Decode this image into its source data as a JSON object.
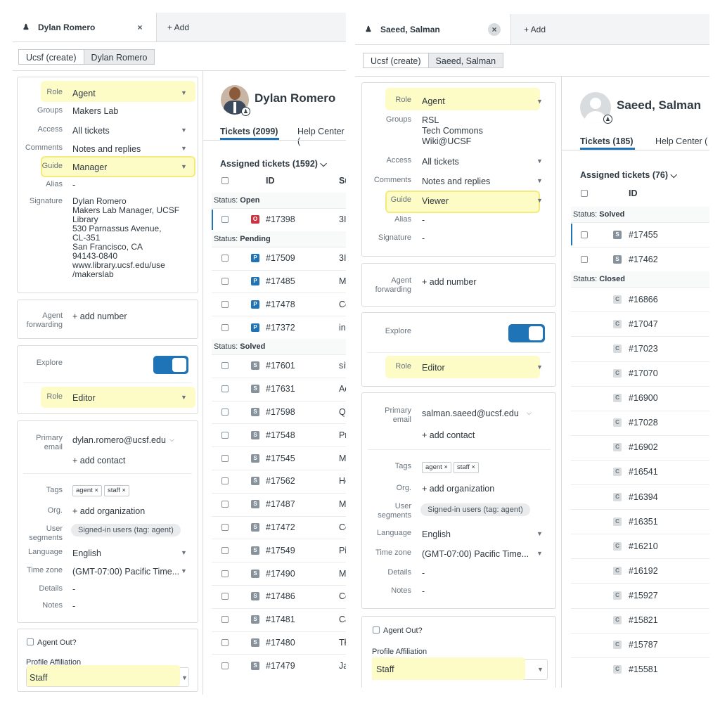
{
  "left": {
    "tab_label": "Dylan Romero",
    "tab_close": "×",
    "add_tab": "+ Add",
    "breadcrumbs": [
      "Ucsf (create)",
      "Dylan Romero"
    ],
    "profile": {
      "role_label": "Role",
      "role_value": "Agent",
      "groups_label": "Groups",
      "groups_value": "Makers Lab",
      "access_label": "Access",
      "access_value": "All tickets",
      "comments_label": "Comments",
      "comments_value": "Notes and replies",
      "guide_label": "Guide",
      "guide_value": "Manager",
      "alias_label": "Alias",
      "alias_value": "-",
      "signature_label": "Signature",
      "signature_lines": [
        "Dylan Romero",
        "Makers Lab Manager, UCSF",
        "Library",
        "530 Parnassus Avenue,",
        "CL-351",
        "San Francisco, CA",
        "94143-0840",
        "www.library.ucsf.edu/use",
        "/makerslab"
      ]
    },
    "forwarding": {
      "label_line1": "Agent",
      "label_line2": "forwarding",
      "value": "+ add number"
    },
    "explore": {
      "label": "Explore",
      "role_label": "Role",
      "role_value": "Editor"
    },
    "contact": {
      "email_label_1": "Primary",
      "email_label_2": "email",
      "email_value": "dylan.romero@ucsf.edu",
      "add_contact": "+ add contact",
      "tags_label": "Tags",
      "tags": [
        "agent ×",
        "staff ×"
      ],
      "org_label": "Org.",
      "org_value": "+ add organization",
      "segments_label_1": "User",
      "segments_label_2": "segments",
      "segments_value": "Signed-in users (tag: agent)",
      "language_label": "Language",
      "language_value": "English",
      "timezone_label": "Time zone",
      "timezone_value": "(GMT-07:00) Pacific Time...",
      "details_label": "Details",
      "details_value": "-",
      "notes_label": "Notes",
      "notes_value": "-"
    },
    "agent_out": "Agent Out?",
    "affiliation_label": "Profile Affiliation",
    "affiliation_value": "Staff",
    "user_name": "Dylan Romero",
    "tabs": [
      "Tickets (2099)",
      "Help Center ("
    ],
    "assigned": "Assigned tickets (1592) ⌵",
    "col_id": "ID",
    "col_subject": "Su",
    "groups": [
      {
        "header_prefix": "Status: ",
        "header_status": "Open",
        "rows": [
          {
            "badge": "O",
            "id": "#17398",
            "subj": "3I"
          }
        ]
      },
      {
        "header_prefix": "Status: ",
        "header_status": "Pending",
        "rows": [
          {
            "badge": "P",
            "id": "#17509",
            "subj": "3I"
          },
          {
            "badge": "P",
            "id": "#17485",
            "subj": "M"
          },
          {
            "badge": "P",
            "id": "#17478",
            "subj": "Cc"
          },
          {
            "badge": "P",
            "id": "#17372",
            "subj": "in"
          }
        ]
      },
      {
        "header_prefix": "Status: ",
        "header_status": "Solved",
        "rows": [
          {
            "badge": "S",
            "id": "#17601",
            "subj": "sil"
          },
          {
            "badge": "S",
            "id": "#17631",
            "subj": "Ac"
          },
          {
            "badge": "S",
            "id": "#17598",
            "subj": "Qu"
          },
          {
            "badge": "S",
            "id": "#17548",
            "subj": "Pr"
          },
          {
            "badge": "S",
            "id": "#17545",
            "subj": "M"
          },
          {
            "badge": "S",
            "id": "#17562",
            "subj": "He"
          },
          {
            "badge": "S",
            "id": "#17487",
            "subj": "M"
          },
          {
            "badge": "S",
            "id": "#17472",
            "subj": "Cc"
          },
          {
            "badge": "S",
            "id": "#17549",
            "subj": "Pi"
          },
          {
            "badge": "S",
            "id": "#17490",
            "subj": "M"
          },
          {
            "badge": "S",
            "id": "#17486",
            "subj": "Cc"
          },
          {
            "badge": "S",
            "id": "#17481",
            "subj": "Ca"
          },
          {
            "badge": "S",
            "id": "#17480",
            "subj": "Tł"
          },
          {
            "badge": "S",
            "id": "#17479",
            "subj": "Ja"
          }
        ]
      }
    ]
  },
  "right": {
    "tab_label": "Saeed, Salman",
    "tab_close": "×",
    "add_tab": "+ Add",
    "breadcrumbs": [
      "Ucsf (create)",
      "Saeed, Salman"
    ],
    "profile": {
      "role_label": "Role",
      "role_value": "Agent",
      "groups_label": "Groups",
      "groups_values": [
        "RSL",
        "Tech Commons",
        "Wiki@UCSF"
      ],
      "access_label": "Access",
      "access_value": "All tickets",
      "comments_label": "Comments",
      "comments_value": "Notes and replies",
      "guide_label": "Guide",
      "guide_value": "Viewer",
      "alias_label": "Alias",
      "alias_value": "-",
      "signature_label": "Signature",
      "signature_value": "-"
    },
    "forwarding": {
      "label_line1": "Agent",
      "label_line2": "forwarding",
      "value": "+ add number"
    },
    "explore": {
      "label": "Explore",
      "role_label": "Role",
      "role_value": "Editor"
    },
    "contact": {
      "email_label_1": "Primary",
      "email_label_2": "email",
      "email_value": "salman.saeed@ucsf.edu",
      "add_contact": "+ add contact",
      "tags_label": "Tags",
      "tags": [
        "agent ×",
        "staff ×"
      ],
      "org_label": "Org.",
      "org_value": "+ add organization",
      "segments_label_1": "User",
      "segments_label_2": "segments",
      "segments_value": "Signed-in users (tag: agent)",
      "language_label": "Language",
      "language_value": "English",
      "timezone_label": "Time zone",
      "timezone_value": "(GMT-07:00) Pacific Time...",
      "details_label": "Details",
      "details_value": "-",
      "notes_label": "Notes",
      "notes_value": "-"
    },
    "agent_out": "Agent Out?",
    "affiliation_label": "Profile Affiliation",
    "affiliation_value": "Staff",
    "user_name": "Saeed, Salman",
    "tabs": [
      "Tickets (185)",
      "Help Center ("
    ],
    "assigned": "Assigned tickets (76) ⌵",
    "col_id": "ID",
    "groups": [
      {
        "header_prefix": "Status: ",
        "header_status": "Solved",
        "rows": [
          {
            "badge": "S",
            "id": "#17455"
          },
          {
            "badge": "S",
            "id": "#17462"
          }
        ]
      },
      {
        "header_prefix": "Status: ",
        "header_status": "Closed",
        "rows": [
          {
            "badge": "C",
            "id": "#16866"
          },
          {
            "badge": "C",
            "id": "#17047"
          },
          {
            "badge": "C",
            "id": "#17023"
          },
          {
            "badge": "C",
            "id": "#17070"
          },
          {
            "badge": "C",
            "id": "#16900"
          },
          {
            "badge": "C",
            "id": "#17028"
          },
          {
            "badge": "C",
            "id": "#16902"
          },
          {
            "badge": "C",
            "id": "#16541"
          },
          {
            "badge": "C",
            "id": "#16394"
          },
          {
            "badge": "C",
            "id": "#16351"
          },
          {
            "badge": "C",
            "id": "#16210"
          },
          {
            "badge": "C",
            "id": "#16192"
          },
          {
            "badge": "C",
            "id": "#15927"
          },
          {
            "badge": "C",
            "id": "#15821"
          },
          {
            "badge": "C",
            "id": "#15787"
          },
          {
            "badge": "C",
            "id": "#15581"
          }
        ]
      }
    ]
  }
}
